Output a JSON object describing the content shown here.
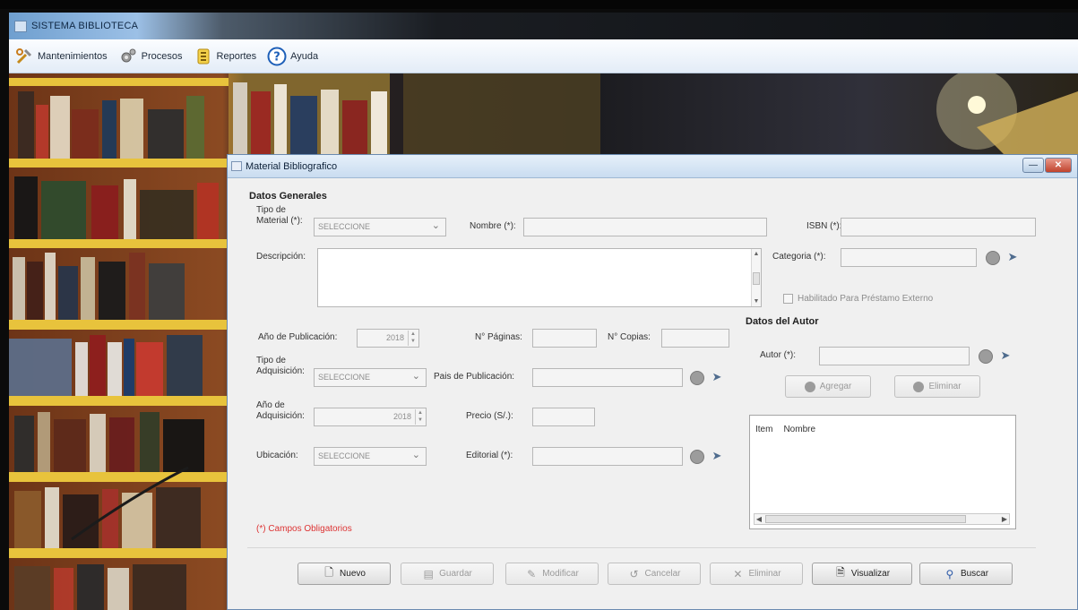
{
  "app": {
    "title": "SISTEMA BIBLIOTECA"
  },
  "menu": [
    {
      "label": "Mantenimientos",
      "icon": "tools-icon"
    },
    {
      "label": "Procesos",
      "icon": "gears-icon"
    },
    {
      "label": "Reportes",
      "icon": "report-icon"
    },
    {
      "label": "Ayuda",
      "icon": "help-icon"
    }
  ],
  "dialog": {
    "title": "Material Bibliografico",
    "datos_generales": "Datos Generales",
    "datos_autor": "Datos del Autor",
    "labels": {
      "tipo_material": "Tipo de\nMaterial (*):",
      "nombre": "Nombre (*):",
      "isbn": "ISBN (*):",
      "descripcion": "Descripción:",
      "categoria": "Categoria (*):",
      "habilitado": "Habilitado Para Préstamo Externo",
      "anio_publicacion": "Año de Publicación:",
      "num_paginas": "N° Páginas:",
      "num_copias": "N° Copias:",
      "tipo_adquisicion": "Tipo de\nAdquisición:",
      "pais_publicacion": "Pais de Publicación:",
      "anio_adquisicion": "Año de\nAdquisición:",
      "precio": "Precio (S/.):",
      "ubicacion": "Ubicación:",
      "editorial": "Editorial (*):",
      "autor": "Autor (*):"
    },
    "values": {
      "tipo_material": "SELECCIONE",
      "tipo_adquisicion": "SELECCIONE",
      "ubicacion": "SELECCIONE",
      "anio_publicacion": "2018",
      "anio_adquisicion": "2018"
    },
    "autor_buttons": {
      "agregar": "Agregar",
      "eliminar": "Eliminar"
    },
    "table_headers": [
      "Item",
      "Nombre"
    ],
    "required_note": "(*) Campos Obligatorios",
    "buttons": {
      "nuevo": "Nuevo",
      "guardar": "Guardar",
      "modificar": "Modificar",
      "cancelar": "Cancelar",
      "eliminar": "Eliminar",
      "visualizar": "Visualizar",
      "buscar": "Buscar"
    }
  }
}
